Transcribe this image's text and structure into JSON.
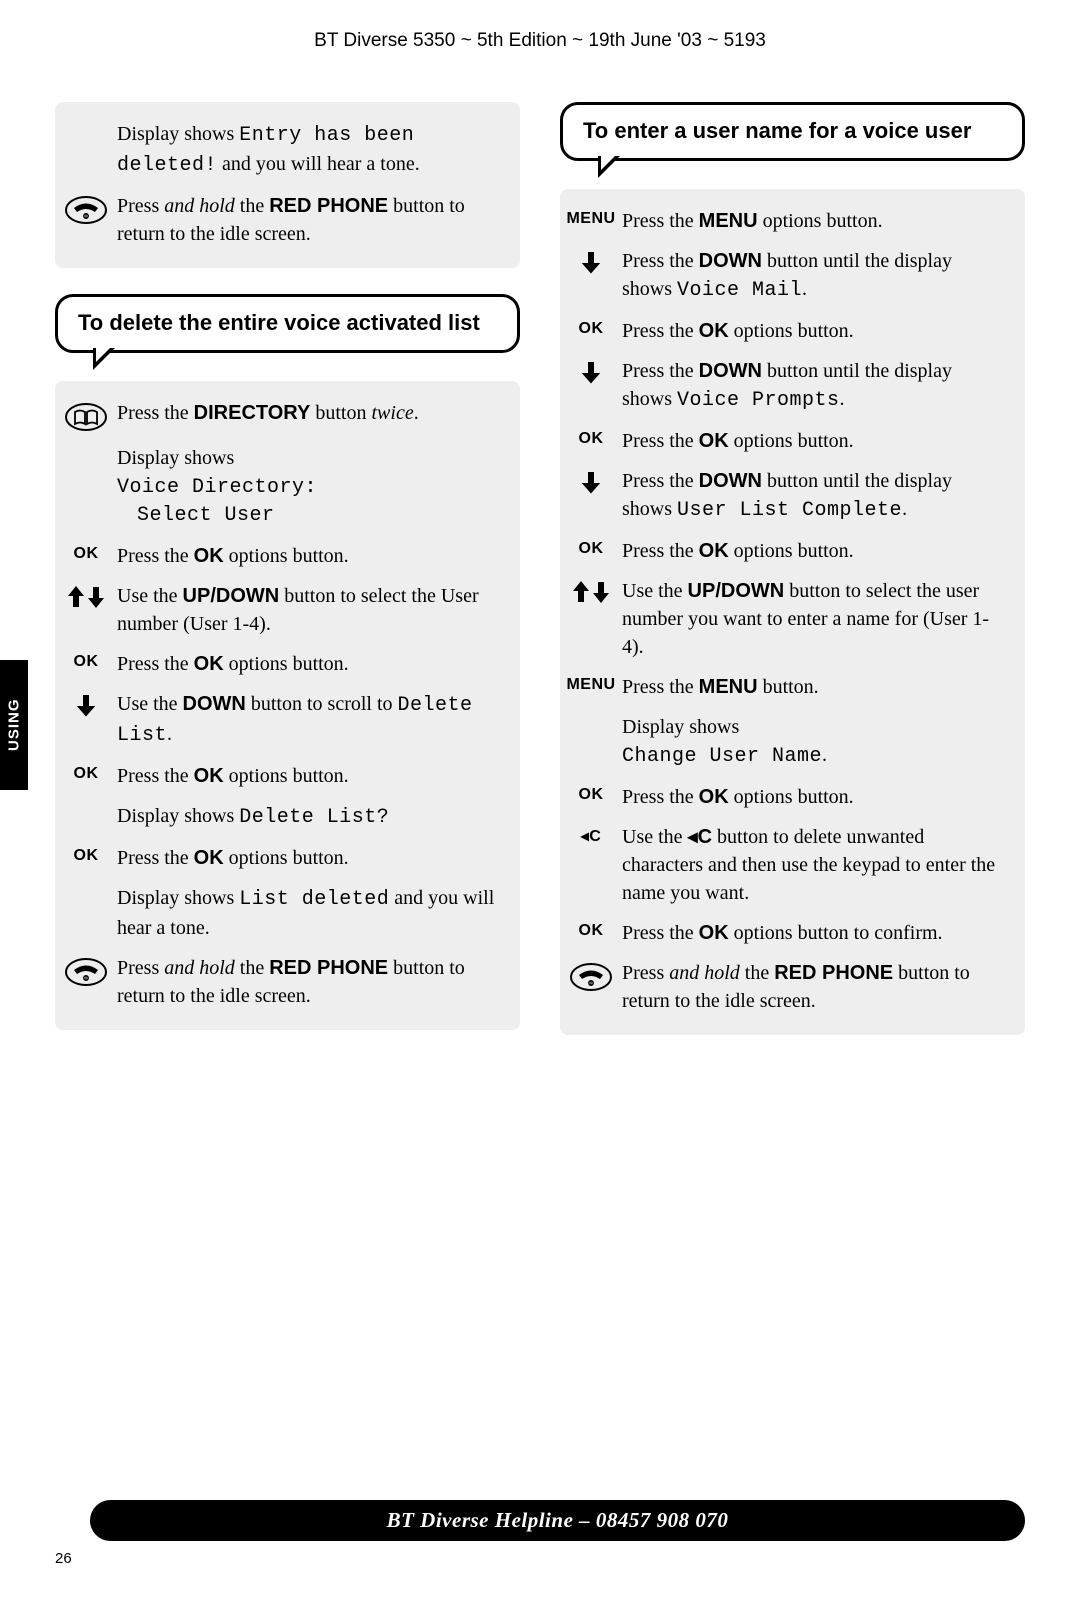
{
  "header": "BT Diverse 5350 ~ 5th Edition ~ 19th June '03 ~ 5193",
  "side_tab": "USING",
  "left": {
    "intro_steps": [
      {
        "icon": "none",
        "parts": [
          {
            "t": "plain",
            "v": "Display shows "
          },
          {
            "t": "lcd",
            "v": "Entry has been deleted!"
          },
          {
            "t": "plain",
            "v": " and you will hear a tone."
          }
        ]
      },
      {
        "icon": "redphone",
        "parts": [
          {
            "t": "plain",
            "v": "Press "
          },
          {
            "t": "em",
            "v": "and hold"
          },
          {
            "t": "plain",
            "v": " the "
          },
          {
            "t": "strong",
            "v": "RED PHONE"
          },
          {
            "t": "plain",
            "v": " button to return to the idle screen."
          }
        ]
      }
    ],
    "callout": "To delete the entire voice activated list",
    "steps": [
      {
        "icon": "book",
        "parts": [
          {
            "t": "plain",
            "v": "Press the "
          },
          {
            "t": "strong",
            "v": "DIRECTORY"
          },
          {
            "t": "plain",
            "v": " button "
          },
          {
            "t": "em",
            "v": "twice"
          },
          {
            "t": "plain",
            "v": "."
          }
        ]
      },
      {
        "icon": "none",
        "parts": [
          {
            "t": "plain",
            "v": "Display shows"
          },
          {
            "t": "br"
          },
          {
            "t": "lcd",
            "v": "Voice Directory:"
          },
          {
            "t": "br"
          },
          {
            "t": "lcd-indent",
            "v": "Select User"
          }
        ]
      },
      {
        "icon": "ok",
        "parts": [
          {
            "t": "plain",
            "v": "Press the "
          },
          {
            "t": "strong",
            "v": "OK"
          },
          {
            "t": "plain",
            "v": " options button."
          }
        ]
      },
      {
        "icon": "updown",
        "parts": [
          {
            "t": "plain",
            "v": "Use the "
          },
          {
            "t": "strong",
            "v": "UP/DOWN"
          },
          {
            "t": "plain",
            "v": " button to select the User number (User 1-4)."
          }
        ]
      },
      {
        "icon": "ok",
        "parts": [
          {
            "t": "plain",
            "v": "Press the "
          },
          {
            "t": "strong",
            "v": "OK"
          },
          {
            "t": "plain",
            "v": " options button."
          }
        ]
      },
      {
        "icon": "down",
        "parts": [
          {
            "t": "plain",
            "v": "Use the "
          },
          {
            "t": "strong",
            "v": "DOWN"
          },
          {
            "t": "plain",
            "v": " button to scroll to "
          },
          {
            "t": "lcd",
            "v": "Delete List"
          },
          {
            "t": "plain",
            "v": "."
          }
        ]
      },
      {
        "icon": "ok",
        "parts": [
          {
            "t": "plain",
            "v": "Press the "
          },
          {
            "t": "strong",
            "v": "OK"
          },
          {
            "t": "plain",
            "v": " options button."
          }
        ]
      },
      {
        "icon": "none",
        "parts": [
          {
            "t": "plain",
            "v": "Display shows "
          },
          {
            "t": "lcd",
            "v": "Delete List?"
          }
        ]
      },
      {
        "icon": "ok",
        "parts": [
          {
            "t": "plain",
            "v": "Press the "
          },
          {
            "t": "strong",
            "v": "OK"
          },
          {
            "t": "plain",
            "v": " options button."
          }
        ]
      },
      {
        "icon": "none",
        "parts": [
          {
            "t": "plain",
            "v": "Display shows "
          },
          {
            "t": "lcd",
            "v": "List deleted"
          },
          {
            "t": "plain",
            "v": " and you will hear a tone."
          }
        ]
      },
      {
        "icon": "redphone",
        "parts": [
          {
            "t": "plain",
            "v": "Press "
          },
          {
            "t": "em",
            "v": "and hold"
          },
          {
            "t": "plain",
            "v": " the "
          },
          {
            "t": "strong",
            "v": "RED PHONE"
          },
          {
            "t": "plain",
            "v": " button to return to the idle screen."
          }
        ]
      }
    ]
  },
  "right": {
    "callout": "To enter a user name for a voice user",
    "steps": [
      {
        "icon": "menu",
        "parts": [
          {
            "t": "plain",
            "v": "Press the "
          },
          {
            "t": "strong",
            "v": "MENU"
          },
          {
            "t": "plain",
            "v": " options button."
          }
        ]
      },
      {
        "icon": "down",
        "parts": [
          {
            "t": "plain",
            "v": "Press the "
          },
          {
            "t": "strong",
            "v": "DOWN"
          },
          {
            "t": "plain",
            "v": " button until the display shows "
          },
          {
            "t": "lcd",
            "v": "Voice Mail"
          },
          {
            "t": "plain",
            "v": "."
          }
        ]
      },
      {
        "icon": "ok",
        "parts": [
          {
            "t": "plain",
            "v": "Press the "
          },
          {
            "t": "strong",
            "v": "OK"
          },
          {
            "t": "plain",
            "v": " options button."
          }
        ]
      },
      {
        "icon": "down",
        "parts": [
          {
            "t": "plain",
            "v": "Press the "
          },
          {
            "t": "strong",
            "v": "DOWN"
          },
          {
            "t": "plain",
            "v": " button until the display shows "
          },
          {
            "t": "lcd",
            "v": "Voice Prompts"
          },
          {
            "t": "plain",
            "v": "."
          }
        ]
      },
      {
        "icon": "ok",
        "parts": [
          {
            "t": "plain",
            "v": "Press the "
          },
          {
            "t": "strong",
            "v": "OK"
          },
          {
            "t": "plain",
            "v": " options button."
          }
        ]
      },
      {
        "icon": "down",
        "parts": [
          {
            "t": "plain",
            "v": "Press the "
          },
          {
            "t": "strong",
            "v": "DOWN"
          },
          {
            "t": "plain",
            "v": " button until the display shows "
          },
          {
            "t": "lcd",
            "v": "User List Complete"
          },
          {
            "t": "plain",
            "v": "."
          }
        ]
      },
      {
        "icon": "ok",
        "parts": [
          {
            "t": "plain",
            "v": "Press the "
          },
          {
            "t": "strong",
            "v": "OK"
          },
          {
            "t": "plain",
            "v": " options button."
          }
        ]
      },
      {
        "icon": "updown",
        "parts": [
          {
            "t": "plain",
            "v": "Use the "
          },
          {
            "t": "strong",
            "v": "UP/DOWN"
          },
          {
            "t": "plain",
            "v": " button to select the user number you want to enter a name for (User 1-4)."
          }
        ]
      },
      {
        "icon": "menu",
        "parts": [
          {
            "t": "plain",
            "v": "Press the "
          },
          {
            "t": "strong",
            "v": "MENU"
          },
          {
            "t": "plain",
            "v": " button."
          }
        ]
      },
      {
        "icon": "none",
        "parts": [
          {
            "t": "plain",
            "v": "Display shows"
          },
          {
            "t": "br"
          },
          {
            "t": "lcd",
            "v": "Change User Name"
          },
          {
            "t": "plain",
            "v": "."
          }
        ]
      },
      {
        "icon": "ok",
        "parts": [
          {
            "t": "plain",
            "v": "Press the "
          },
          {
            "t": "strong",
            "v": "OK"
          },
          {
            "t": "plain",
            "v": " options button."
          }
        ]
      },
      {
        "icon": "backc",
        "parts": [
          {
            "t": "plain",
            "v": "Use the "
          },
          {
            "t": "strong",
            "v": "◂C"
          },
          {
            "t": "plain",
            "v": " button to delete unwanted characters and then use the keypad to enter the name you want."
          }
        ]
      },
      {
        "icon": "ok",
        "parts": [
          {
            "t": "plain",
            "v": "Press the "
          },
          {
            "t": "strong",
            "v": "OK"
          },
          {
            "t": "plain",
            "v": " options button to confirm."
          }
        ]
      },
      {
        "icon": "redphone",
        "parts": [
          {
            "t": "plain",
            "v": "Press "
          },
          {
            "t": "em",
            "v": "and hold"
          },
          {
            "t": "plain",
            "v": " the "
          },
          {
            "t": "strong",
            "v": "RED PHONE"
          },
          {
            "t": "plain",
            "v": " button to return to the idle screen."
          }
        ]
      }
    ]
  },
  "footer": "BT Diverse Helpline – 08457 908 070",
  "page_num": "26",
  "icon_labels": {
    "ok": "OK",
    "menu": "MENU",
    "backc": "◂C"
  }
}
